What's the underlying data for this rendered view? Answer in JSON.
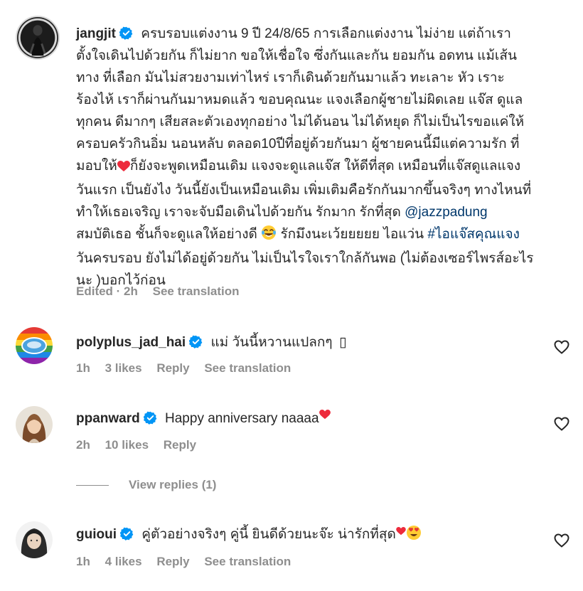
{
  "caption": {
    "username": "jangjit",
    "lines": [
      "ครบรอบแต่งงาน 9 ปี 24/8/65 การเลือกแต่งงาน ไม่ง่าย แต่ถ้าเรา",
      "ตั้งใจเดินไปด้วยกัน ก็ไม่ยาก ขอให้เชื่อใจ ซึ่งกันและกัน ยอมกัน อดทน แม้เส้น",
      "ทาง ที่เลือก มันไม่สวยงามเท่าไหร่ เราก็เดินด้วยกันมาแล้ว ทะเลาะ หัว เราะ",
      "ร้องไห้ เราก็ผ่านกันมาหมดแล้ว ขอบคุณนะ แจงเลือกผู้ชายไม่ผิดเลย แจ๊ส ดูแล",
      "ทุกคน ดีมากๆ เสียสละตัวเองทุกอย่าง ไม่ได้นอน ไม่ได้หยุด ก็ไม่เป็นไรขอแค่ให้",
      "ครอบครัวกินอิ่ม นอนหลับ ตลอด10ปีที่อยู่ด้วยกันมา ผู้ชายคนนี้มีแต่ความรัก ที่"
    ],
    "line7_a": "มอบให้",
    "line7_b": "ก็ยังจะพูดเหมือนเดิม แจงจะดูแลแจ๊ส ให้ดีที่สุด เหมือนที่แจ๊สดูแลแจง",
    "line8": "วันแรก เป็นยังไง วันนี้ยังเป็นเหมือนเดิม เพิ่มเติมคือรักกันมากขึ้นจริงๆ ทางไหนที่",
    "line9": "ทำให้เธอเจริญ เราจะจับมือเดินไปด้วยกัน รักมาก รักที่สุด",
    "mention": "@jazzpadung",
    "line10_a": "สมบัติเธอ ชั้นก็จะดูแลให้อย่างดี",
    "line10_b": "รักมึงนะเว้ยยยยย ไอแว่น",
    "hashtag": "#ไอแจ๊สคุณแจง",
    "line11": "วันครบรอบ ยังไม่ได้อยู่ด้วยกัน ไม่เป็นไรใจเราใกล้กันพอ (ไม่ต้องเซอร์ไพรส์อะไร",
    "line12": "นะ )บอกไว้ก่อน",
    "meta": {
      "edited": "Edited · 2h",
      "see_translation": "See translation"
    }
  },
  "comments": [
    {
      "username": "polyplus_jad_hai",
      "text": "แม่ วันนี้หวานแปลกๆ",
      "trail": "▯",
      "time": "1h",
      "likes": "3 likes",
      "reply": "Reply",
      "see_translation": "See translation"
    },
    {
      "username": "ppanward",
      "text": "Happy anniversary naaaa",
      "time": "2h",
      "likes": "10 likes",
      "reply": "Reply"
    },
    {
      "username": "guioui",
      "text": "คู่ตัวอย่างจริงๆ คู่นี้ ยินดีด้วยนะจ๊ะ น่ารักที่สุด",
      "time": "1h",
      "likes": "4 likes",
      "reply": "Reply",
      "see_translation": "See translation"
    }
  ],
  "view_replies": "View replies (1)",
  "colors": {
    "verified": "#0095f6",
    "link": "#00376b",
    "meta": "#8e8e8e",
    "heart_red": "#ed4956"
  }
}
